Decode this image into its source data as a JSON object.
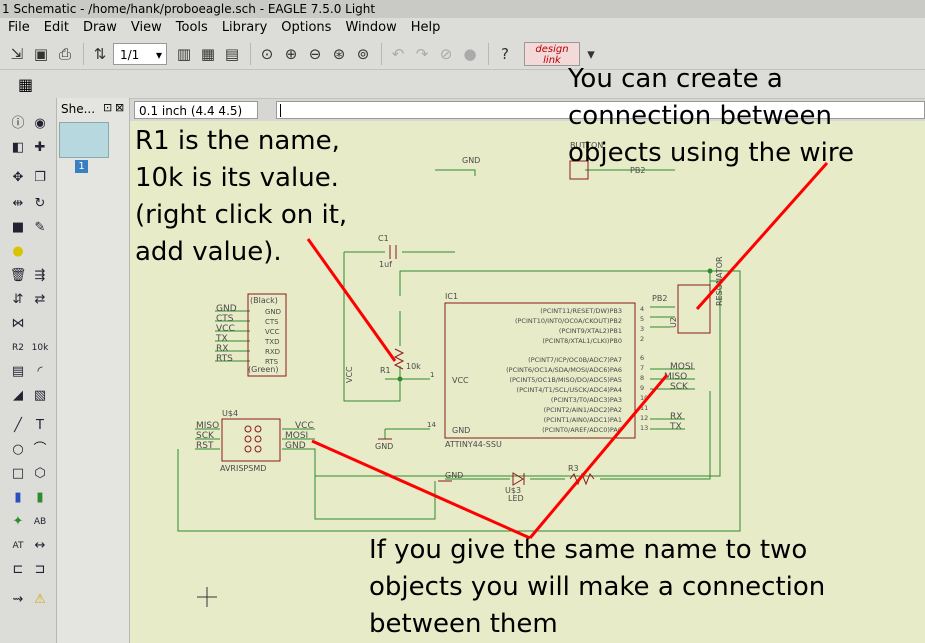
{
  "window": {
    "title": "1 Schematic - /home/hank/proboeagle.sch - EAGLE 7.5.0 Light"
  },
  "menu": [
    "File",
    "Edit",
    "Draw",
    "View",
    "Tools",
    "Library",
    "Options",
    "Window",
    "Help"
  ],
  "toolbar": {
    "zoom_value": "1/1",
    "design_link_line1": "design",
    "design_link_line2": "link"
  },
  "sheet_panel": {
    "header": "She...",
    "sheet_number": "1"
  },
  "coord_box": {
    "value": "0.1 inch (4.4 4.5)"
  },
  "schematic": {
    "labels": {
      "button": "BUTTON",
      "pb2_top": "PB2",
      "gnd_top": "GND",
      "c1": "C1",
      "c1_value": "1uf",
      "ic1": "IC1",
      "ic_name": "ATTINY44-SSU",
      "r1": "R1",
      "r1_value": "10k",
      "vcc_left": "VCC",
      "vcc_pin": "VCC",
      "gnd_pin": "GND",
      "gnd_ic": "GND",
      "resonator": "RESONATOR",
      "u2": "U2",
      "pb2_res": "PB2",
      "mosi": "MOSI",
      "miso": "MISO",
      "sck": "SCK",
      "rx": "RX",
      "tx": "TX",
      "u4": "U$4",
      "avr_name": "AVRISPSMD",
      "avr_miso": "MISO",
      "avr_sck": "SCK",
      "avr_rst": "RST",
      "avr_vcc": "VCC",
      "avr_mosi": "MOSI",
      "avr_gnd": "GND",
      "u3": "U$3",
      "led": "LED",
      "r3": "R3",
      "gnd_led": "GND",
      "black": "(Black)",
      "green": "(Green)"
    },
    "ftdi_pins": [
      "GND",
      "CTS",
      "VCC",
      "TXD",
      "RXD",
      "RTS"
    ],
    "ftdi_nets": [
      "GND",
      "CTS",
      "VCC",
      "TX",
      "RX",
      "RTS"
    ],
    "ic_pins_right": [
      "(PCINT11/RESET/DW)PB3",
      "(PCINT10/INT0/OC0A/CKOUT)PB2",
      "(PCINT9/XTAL2)PB1",
      "(PCINT8/XTAL1/CLKI)PB0",
      "(PCINT7/ICP/OC0B/ADC7)PA7",
      "(PCINT6/OC1A/SDA/MOSI/ADC6)PA6",
      "(PCINT5/OC1B/MISO/DO/ADC5)PA5",
      "(PCINT4/T1/SCL/USCK/ADC4)PA4",
      "(PCINT3/T0/ADC3)PA3",
      "(PCINT2/AIN1/ADC2)PA2",
      "(PCINT1/AIN0/ADC1)PA1",
      "(PCINT0/AREF/ADC0)PA0"
    ],
    "ic_pin_numbers": [
      "4",
      "5",
      "3",
      "2",
      "6",
      "7",
      "8",
      "9",
      "10",
      "11",
      "12",
      "13"
    ],
    "ic_left_pins": [
      "1",
      "14"
    ],
    "colors": {
      "wire": "#2e8b2e",
      "part": "#8b1a1a",
      "annotation_line": "#ff0000"
    }
  },
  "annotations": {
    "r1_note": "R1 is the name,\n10k is its value.\n(right click on it,\nadd value).",
    "wire_note": "You can create a\nconnection between\nobjects using the wire",
    "name_note": "If you give the same name to two\nobjects you will make a connection\nbetween them"
  }
}
